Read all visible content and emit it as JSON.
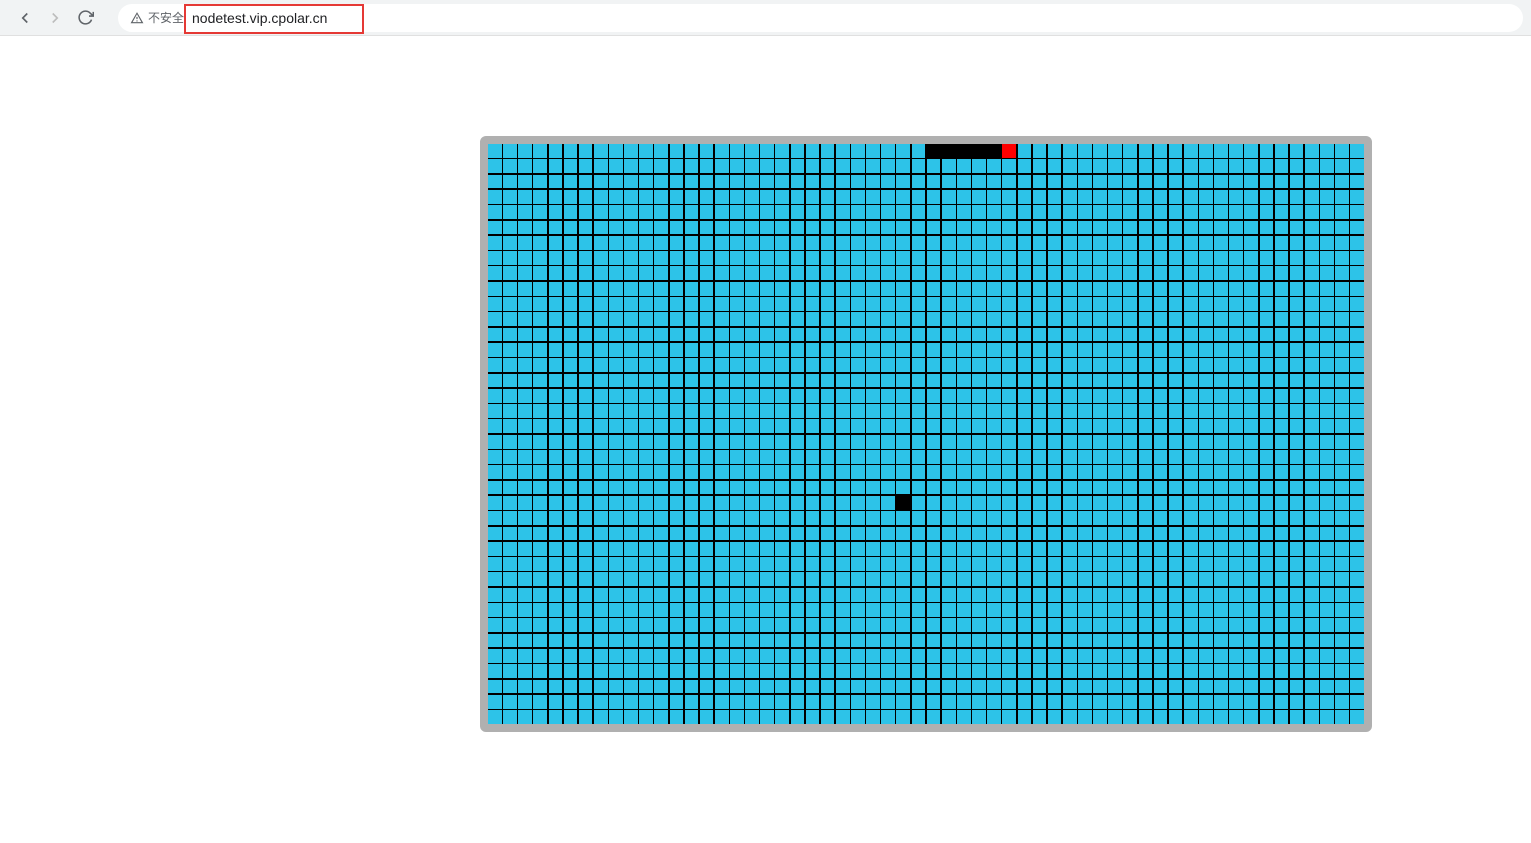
{
  "browser": {
    "security_label": "不安全",
    "url": "nodetest.vip.cpolar.cn"
  },
  "game": {
    "grid": {
      "cols": 58,
      "rows": 38
    },
    "colors": {
      "cell": "#2dc3e8",
      "snake": "#000000",
      "head": "#ff0000",
      "food": "#000000",
      "border": "#b0b0b0",
      "gap": "#000000"
    },
    "snake_body": [
      {
        "row": 0,
        "col": 29
      },
      {
        "row": 0,
        "col": 30
      },
      {
        "row": 0,
        "col": 31
      },
      {
        "row": 0,
        "col": 32
      },
      {
        "row": 0,
        "col": 33
      }
    ],
    "snake_head": {
      "row": 0,
      "col": 34
    },
    "food": {
      "row": 23,
      "col": 27
    }
  }
}
